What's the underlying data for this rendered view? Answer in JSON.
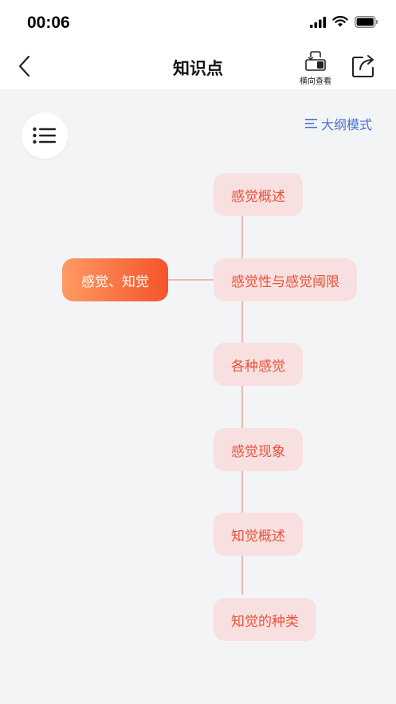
{
  "status_bar": {
    "time": "00:06",
    "icons": [
      "signal-icon",
      "wifi-icon",
      "battery-icon"
    ]
  },
  "nav": {
    "title": "知识点",
    "landscape_label": "横向查看"
  },
  "toolbar": {
    "outline_label": "大纲模式"
  },
  "mindmap": {
    "root": "感觉、知觉",
    "children": [
      "感觉概述",
      "感觉性与感觉阈限",
      "各种感觉",
      "感觉现象",
      "知觉概述",
      "知觉的种类"
    ]
  },
  "colors": {
    "accent_blue": "#4a6fd6",
    "node_text": "#e9533a",
    "node_bg": "#f9e0e0",
    "root_gradient_start": "#ff9a63",
    "root_gradient_end": "#f4542a"
  }
}
